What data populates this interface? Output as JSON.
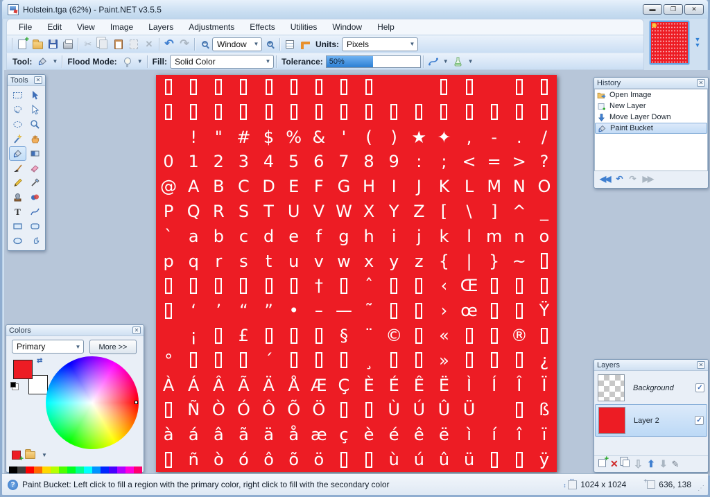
{
  "window": {
    "title": "Holstein.tga (62%) - Paint.NET v3.5.5",
    "controls": [
      "minimize-icon",
      "maximize-icon",
      "close-icon"
    ]
  },
  "menu": {
    "items": [
      "File",
      "Edit",
      "View",
      "Image",
      "Layers",
      "Adjustments",
      "Effects",
      "Utilities",
      "Window",
      "Help"
    ]
  },
  "toolbar": {
    "icons": [
      "new-icon",
      "open-icon",
      "save-icon",
      "print-icon",
      "cut-icon",
      "copy-icon",
      "paste-icon",
      "crop-icon",
      "deselect-icon",
      "undo-icon",
      "redo-icon",
      "zoom-out-icon",
      "zoom-in-icon",
      "grid-icon",
      "ruler-icon"
    ],
    "zoom_dropdown": "Window",
    "units_label": "Units:",
    "units_value": "Pixels"
  },
  "tool_options": {
    "tool_label": "Tool:",
    "flood_mode_label": "Flood Mode:",
    "fill_label": "Fill:",
    "fill_value": "Solid Color",
    "tolerance_label": "Tolerance:",
    "tolerance_value": "50%",
    "tolerance_percent": 50,
    "extra_icons": [
      "antialiasing-icon",
      "blend-mode-icon"
    ]
  },
  "tools_panel": {
    "title": "Tools",
    "selected_index": 8,
    "items": [
      "rectangle-select",
      "move-selected-pixels",
      "lasso-select",
      "move-selection",
      "ellipse-select",
      "zoom",
      "magic-wand",
      "pan",
      "paint-bucket",
      "gradient",
      "paintbrush",
      "eraser",
      "pencil",
      "color-picker",
      "clone-stamp",
      "recolor",
      "text",
      "line-curve",
      "rectangle",
      "rounded-rectangle",
      "ellipse",
      "freeform-shape"
    ]
  },
  "history_panel": {
    "title": "History",
    "items": [
      {
        "label": "Open Image",
        "icon": "open-folder",
        "selected": false
      },
      {
        "label": "New Layer",
        "icon": "new-layer",
        "selected": false
      },
      {
        "label": "Move Layer Down",
        "icon": "move-down",
        "selected": false
      },
      {
        "label": "Paint Bucket",
        "icon": "paint-bucket",
        "selected": true
      }
    ],
    "nav_icons": [
      "rewind-icon",
      "undo-icon",
      "redo-icon",
      "fast-forward-icon"
    ]
  },
  "layers_panel": {
    "title": "Layers",
    "layers": [
      {
        "name": "Background",
        "visible": true,
        "selected": false,
        "thumb": "checker",
        "italic": true
      },
      {
        "name": "Layer 2",
        "visible": true,
        "selected": true,
        "thumb": "#ED1C24",
        "italic": false
      }
    ],
    "toolbar_icons": [
      "add-layer-icon",
      "delete-layer-icon",
      "duplicate-layer-icon",
      "merge-down-icon",
      "move-layer-up-icon",
      "move-layer-down-icon",
      "layer-properties-icon"
    ]
  },
  "colors_panel": {
    "title": "Colors",
    "mode_dropdown": "Primary",
    "more_button": "More >>",
    "primary": "#ED1C24",
    "secondary": "#FFFFFF",
    "palette_row1": [
      "#000000",
      "#404040",
      "#FF0000",
      "#FF6A00",
      "#FFD800",
      "#B6FF00",
      "#4CFF00",
      "#00FF21",
      "#00FF90",
      "#00FFFF",
      "#0094FF",
      "#0026FF",
      "#4800FF",
      "#B200FF",
      "#FF00DC",
      "#FF006E"
    ],
    "palette_row2": [
      "#FFFFFF",
      "#808080",
      "#7F0000",
      "#7F3300",
      "#7F6A00",
      "#5B7F00",
      "#267F00",
      "#007F0E",
      "#007F46",
      "#007F7F",
      "#004A7F",
      "#00137F",
      "#21007F",
      "#57007F",
      "#7F006E",
      "#7F0037"
    ]
  },
  "canvas": {
    "background": "#ED1C24",
    "glyph_color": "#FFFFFF",
    "grid": [
      [
        "□",
        "□",
        "□",
        "□",
        "□",
        "□",
        "□",
        "□",
        "□",
        "",
        "",
        "□",
        "□",
        "",
        "□",
        "□"
      ],
      [
        "□",
        "□",
        "□",
        "□",
        "□",
        "□",
        "□",
        "□",
        "□",
        "□",
        "□",
        "□",
        "□",
        "□",
        "□",
        "□"
      ],
      [
        "",
        "!",
        "\"",
        "#",
        "$",
        "%",
        "&",
        "'",
        "(",
        ")",
        "★",
        "✦",
        ",",
        "-",
        ".",
        "/"
      ],
      [
        "0",
        "1",
        "2",
        "3",
        "4",
        "5",
        "6",
        "7",
        "8",
        "9",
        ":",
        ";",
        "<",
        "=",
        ">",
        "?"
      ],
      [
        "@",
        "A",
        "B",
        "C",
        "D",
        "E",
        "F",
        "G",
        "H",
        "I",
        "J",
        "K",
        "L",
        "M",
        "N",
        "O"
      ],
      [
        "P",
        "Q",
        "R",
        "S",
        "T",
        "U",
        "V",
        "W",
        "X",
        "Y",
        "Z",
        "[",
        "\\",
        "]",
        "^",
        "_"
      ],
      [
        "`",
        "a",
        "b",
        "c",
        "d",
        "e",
        "f",
        "g",
        "h",
        "i",
        "j",
        "k",
        "l",
        "m",
        "n",
        "o"
      ],
      [
        "p",
        "q",
        "r",
        "s",
        "t",
        "u",
        "v",
        "w",
        "x",
        "y",
        "z",
        "{",
        "|",
        "}",
        "~",
        "□"
      ],
      [
        "□",
        "□",
        "□",
        "□",
        "□",
        "□",
        "†",
        "□",
        "ˆ",
        "□",
        "□",
        "‹",
        "Œ",
        "□",
        "□",
        "□"
      ],
      [
        "□",
        "‘",
        "’",
        "“",
        "”",
        "•",
        "–",
        "—",
        "˜",
        "□",
        "□",
        "›",
        "œ",
        "□",
        "□",
        "Ÿ"
      ],
      [
        "",
        "¡",
        "□",
        "£",
        "□",
        "□",
        "□",
        "§",
        "¨",
        "©",
        "□",
        "«",
        "□",
        "□",
        "®",
        "□"
      ],
      [
        "°",
        "□",
        "□",
        "□",
        "´",
        "□",
        "□",
        "□",
        "¸",
        "□",
        "□",
        "»",
        "□",
        "□",
        "□",
        "¿"
      ],
      [
        "À",
        "Á",
        "Â",
        "Ã",
        "Ä",
        "Å",
        "Æ",
        "Ç",
        "È",
        "É",
        "Ê",
        "Ë",
        "Ì",
        "Í",
        "Î",
        "Ï"
      ],
      [
        "□",
        "Ñ",
        "Ò",
        "Ó",
        "Ô",
        "Õ",
        "Ö",
        "□",
        "□",
        "Ù",
        "Ú",
        "Û",
        "Ü",
        "",
        "□",
        "ß"
      ],
      [
        "à",
        "á",
        "â",
        "ã",
        "ä",
        "å",
        "æ",
        "ç",
        "è",
        "é",
        "ê",
        "ë",
        "ì",
        "í",
        "î",
        "ï"
      ],
      [
        "□",
        "ñ",
        "ò",
        "ó",
        "ô",
        "õ",
        "ö",
        "□",
        "□",
        "ù",
        "ú",
        "û",
        "ü",
        "□",
        "□",
        "ÿ"
      ]
    ]
  },
  "status_bar": {
    "help_text": "Paint Bucket: Left click to fill a region with the primary color, right click to fill with the secondary color",
    "image_size": "1024 x 1024",
    "cursor_position": "636, 138"
  }
}
